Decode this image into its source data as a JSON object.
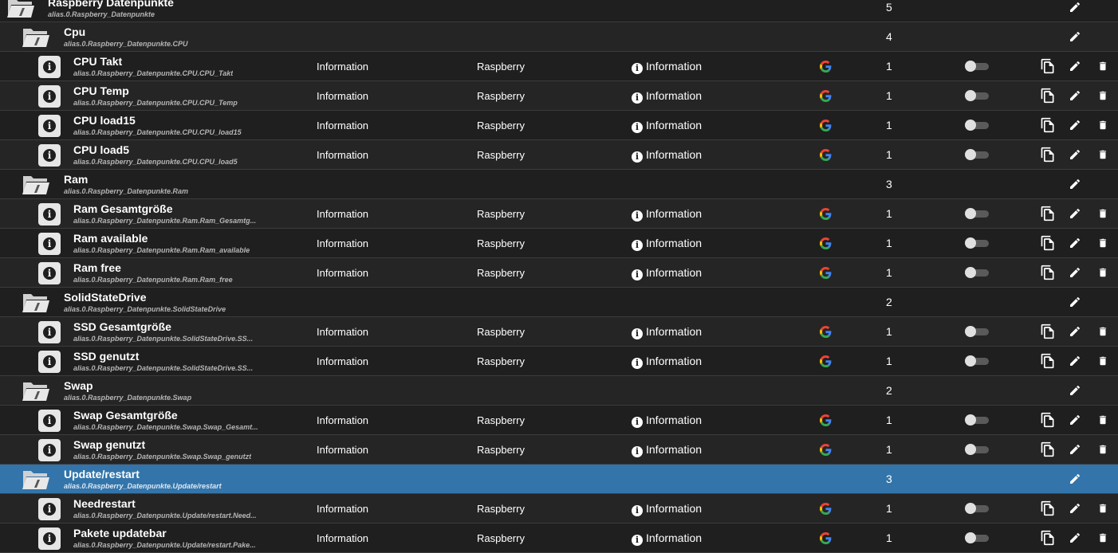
{
  "columns": {
    "type": "Information",
    "room": "Raspberry",
    "role": "Information"
  },
  "rows": [
    {
      "kind": "folder",
      "level": 0,
      "title": "Raspberry Datenpunkte",
      "subtitle": "alias.0.Raspberry_Datenpunkte",
      "count": "5"
    },
    {
      "kind": "folder",
      "level": 1,
      "title": "Cpu",
      "subtitle": "alias.0.Raspberry_Datenpunkte.CPU",
      "count": "4"
    },
    {
      "kind": "item",
      "title": "CPU Takt",
      "subtitle": "alias.0.Raspberry_Datenpunkte.CPU.CPU_Takt",
      "count": "1"
    },
    {
      "kind": "item",
      "title": "CPU Temp",
      "subtitle": "alias.0.Raspberry_Datenpunkte.CPU.CPU_Temp",
      "count": "1"
    },
    {
      "kind": "item",
      "title": "CPU load15",
      "subtitle": "alias.0.Raspberry_Datenpunkte.CPU.CPU_load15",
      "count": "1"
    },
    {
      "kind": "item",
      "title": "CPU load5",
      "subtitle": "alias.0.Raspberry_Datenpunkte.CPU.CPU_load5",
      "count": "1"
    },
    {
      "kind": "folder",
      "level": 1,
      "title": "Ram",
      "subtitle": "alias.0.Raspberry_Datenpunkte.Ram",
      "count": "3"
    },
    {
      "kind": "item",
      "title": "Ram Gesamtgröße",
      "subtitle": "alias.0.Raspberry_Datenpunkte.Ram.Ram_Gesamtg...",
      "count": "1"
    },
    {
      "kind": "item",
      "title": "Ram available",
      "subtitle": "alias.0.Raspberry_Datenpunkte.Ram.Ram_available",
      "count": "1"
    },
    {
      "kind": "item",
      "title": "Ram free",
      "subtitle": "alias.0.Raspberry_Datenpunkte.Ram.Ram_free",
      "count": "1"
    },
    {
      "kind": "folder",
      "level": 1,
      "title": "SolidStateDrive",
      "subtitle": "alias.0.Raspberry_Datenpunkte.SolidStateDrive",
      "count": "2"
    },
    {
      "kind": "item",
      "title": "SSD Gesamtgröße",
      "subtitle": "alias.0.Raspberry_Datenpunkte.SolidStateDrive.SS...",
      "count": "1"
    },
    {
      "kind": "item",
      "title": "SSD genutzt",
      "subtitle": "alias.0.Raspberry_Datenpunkte.SolidStateDrive.SS...",
      "count": "1"
    },
    {
      "kind": "folder",
      "level": 1,
      "title": "Swap",
      "subtitle": "alias.0.Raspberry_Datenpunkte.Swap",
      "count": "2"
    },
    {
      "kind": "item",
      "title": "Swap Gesamtgröße",
      "subtitle": "alias.0.Raspberry_Datenpunkte.Swap.Swap_Gesamt...",
      "count": "1"
    },
    {
      "kind": "item",
      "title": "Swap genutzt",
      "subtitle": "alias.0.Raspberry_Datenpunkte.Swap.Swap_genutzt",
      "count": "1"
    },
    {
      "kind": "folder",
      "level": 1,
      "selected": true,
      "title": "Update/restart",
      "subtitle": "alias.0.Raspberry_Datenpunkte.Update/restart",
      "count": "3"
    },
    {
      "kind": "item",
      "title": "Needrestart",
      "subtitle": "alias.0.Raspberry_Datenpunkte.Update/restart.Need...",
      "count": "1"
    },
    {
      "kind": "item",
      "title": "Pakete updatebar",
      "subtitle": "alias.0.Raspberry_Datenpunkte.Update/restart.Pake...",
      "count": "1"
    }
  ],
  "icons": {
    "folder": "folder-open-icon",
    "item": "info-icon",
    "smart": "google-icon",
    "copy": "copy-icon",
    "edit": "pencil-icon",
    "delete": "trash-icon"
  },
  "colors": {
    "background": "#1f1f1f",
    "row_alt": "#252525",
    "selected": "#3375aa",
    "divider": "#3c3c3c"
  }
}
